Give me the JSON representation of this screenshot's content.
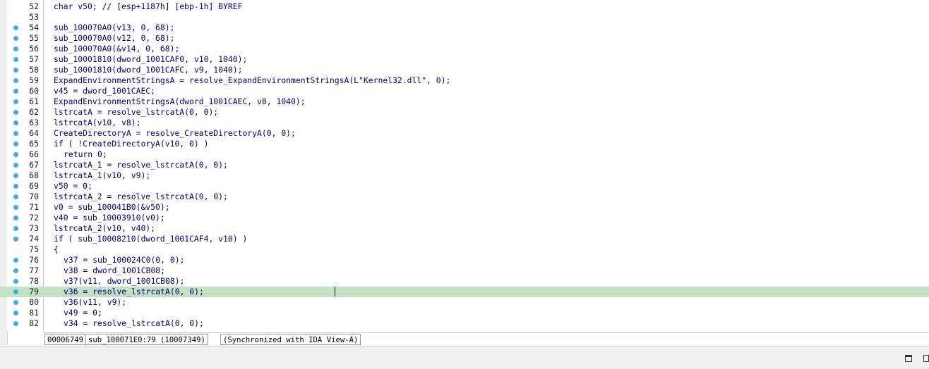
{
  "editor": {
    "lines": [
      {
        "n": "52",
        "text": "char v50; // [esp+1187h] [ebp-1h] BYREF",
        "bp": false,
        "gray": false,
        "indent": false,
        "hl": false
      },
      {
        "n": "53",
        "text": "",
        "bp": false,
        "gray": false,
        "indent": false,
        "hl": false
      },
      {
        "n": "54",
        "text": "sub_100070A0(v13, 0, 68);",
        "bp": true,
        "gray": false,
        "indent": false,
        "hl": false
      },
      {
        "n": "55",
        "text": "sub_100070A0(v12, 0, 68);",
        "bp": true,
        "gray": false,
        "indent": false,
        "hl": false
      },
      {
        "n": "56",
        "text": "sub_100070A0(&v14, 0, 68);",
        "bp": true,
        "gray": false,
        "indent": false,
        "hl": false
      },
      {
        "n": "57",
        "text": "sub_10001810(dword_1001CAF0, v10, 1040);",
        "bp": true,
        "gray": false,
        "indent": false,
        "hl": false
      },
      {
        "n": "58",
        "text": "sub_10001810(dword_1001CAFC, v9, 1040);",
        "bp": true,
        "gray": false,
        "indent": false,
        "hl": false
      },
      {
        "n": "59",
        "text": "ExpandEnvironmentStringsA = resolve_ExpandEnvironmentStringsA(L\"Kernel32.dll\", 0);",
        "bp": true,
        "gray": false,
        "indent": false,
        "hl": false
      },
      {
        "n": "60",
        "text": "v45 = dword_1001CAEC;",
        "bp": true,
        "gray": false,
        "indent": false,
        "hl": false
      },
      {
        "n": "61",
        "text": "ExpandEnvironmentStringsA(dword_1001CAEC, v8, 1040);",
        "bp": true,
        "gray": false,
        "indent": false,
        "hl": false
      },
      {
        "n": "62",
        "text": "lstrcatA = resolve_lstrcatA(0, 0);",
        "bp": true,
        "gray": false,
        "indent": false,
        "hl": false
      },
      {
        "n": "63",
        "text": "lstrcatA(v10, v8);",
        "bp": true,
        "gray": false,
        "indent": false,
        "hl": false
      },
      {
        "n": "64",
        "text": "CreateDirectoryA = resolve_CreateDirectoryA(0, 0);",
        "bp": true,
        "gray": false,
        "indent": false,
        "hl": false
      },
      {
        "n": "65",
        "text": "if ( !CreateDirectoryA(v10, 0) )",
        "bp": true,
        "gray": false,
        "indent": false,
        "hl": false
      },
      {
        "n": "66",
        "text": "return 0;",
        "bp": true,
        "gray": false,
        "indent": true,
        "hl": false
      },
      {
        "n": "67",
        "text": "lstrcatA_1 = resolve_lstrcatA(0, 0);",
        "bp": true,
        "gray": false,
        "indent": false,
        "hl": false
      },
      {
        "n": "68",
        "text": "lstrcatA_1(v10, v9);",
        "bp": true,
        "gray": false,
        "indent": false,
        "hl": false
      },
      {
        "n": "69",
        "text": "v50 = 0;",
        "bp": true,
        "gray": false,
        "indent": false,
        "hl": false
      },
      {
        "n": "70",
        "text": "lstrcatA_2 = resolve_lstrcatA(0, 0);",
        "bp": true,
        "gray": false,
        "indent": false,
        "hl": false
      },
      {
        "n": "71",
        "text": "v0 = sub_100041B0(&v50);",
        "bp": true,
        "gray": false,
        "indent": false,
        "hl": false
      },
      {
        "n": "72",
        "text": "v40 = sub_10003910(v0);",
        "bp": true,
        "gray": false,
        "indent": false,
        "hl": false
      },
      {
        "n": "73",
        "text": "lstrcatA_2(v10, v40);",
        "bp": true,
        "gray": false,
        "indent": false,
        "hl": false
      },
      {
        "n": "74",
        "text": "if ( sub_10008210(dword_1001CAF4, v10) )",
        "bp": true,
        "gray": false,
        "indent": false,
        "hl": false
      },
      {
        "n": "75",
        "text": "{",
        "bp": false,
        "gray": false,
        "indent": false,
        "hl": false
      },
      {
        "n": "76",
        "text": "v37 = sub_100024C0(0, 0);",
        "bp": true,
        "gray": false,
        "indent": true,
        "hl": false
      },
      {
        "n": "77",
        "text": "v38 = dword_1001CB08;",
        "bp": true,
        "gray": false,
        "indent": true,
        "hl": false
      },
      {
        "n": "78",
        "text": "v37(v11, dword_1001CB08);",
        "bp": true,
        "gray": false,
        "indent": true,
        "hl": false
      },
      {
        "n": "79",
        "text": "v36 = resolve_lstrcatA(0, 0);",
        "bp": true,
        "gray": false,
        "indent": true,
        "hl": true
      },
      {
        "n": "80",
        "text": "v36(v11, v9);",
        "bp": true,
        "gray": false,
        "indent": true,
        "hl": false
      },
      {
        "n": "81",
        "text": "v49 = 0;",
        "bp": true,
        "gray": false,
        "indent": true,
        "hl": false
      },
      {
        "n": "82",
        "text": "v34 = resolve_lstrcatA(0, 0);",
        "bp": true,
        "gray": false,
        "indent": true,
        "hl": false
      }
    ]
  },
  "status": {
    "address": "00006749",
    "location": "sub_100071E0:79 (10007349)",
    "sync": "(Synchronized with IDA View-A)"
  },
  "icons": {
    "breakpoint": "breakpoint-dot-icon",
    "restore": "window-restore-icon",
    "float": "window-float-icon"
  },
  "colors": {
    "highlight": "#c3e2c3",
    "breakpoint": "#3daee9",
    "code": "#000080"
  }
}
